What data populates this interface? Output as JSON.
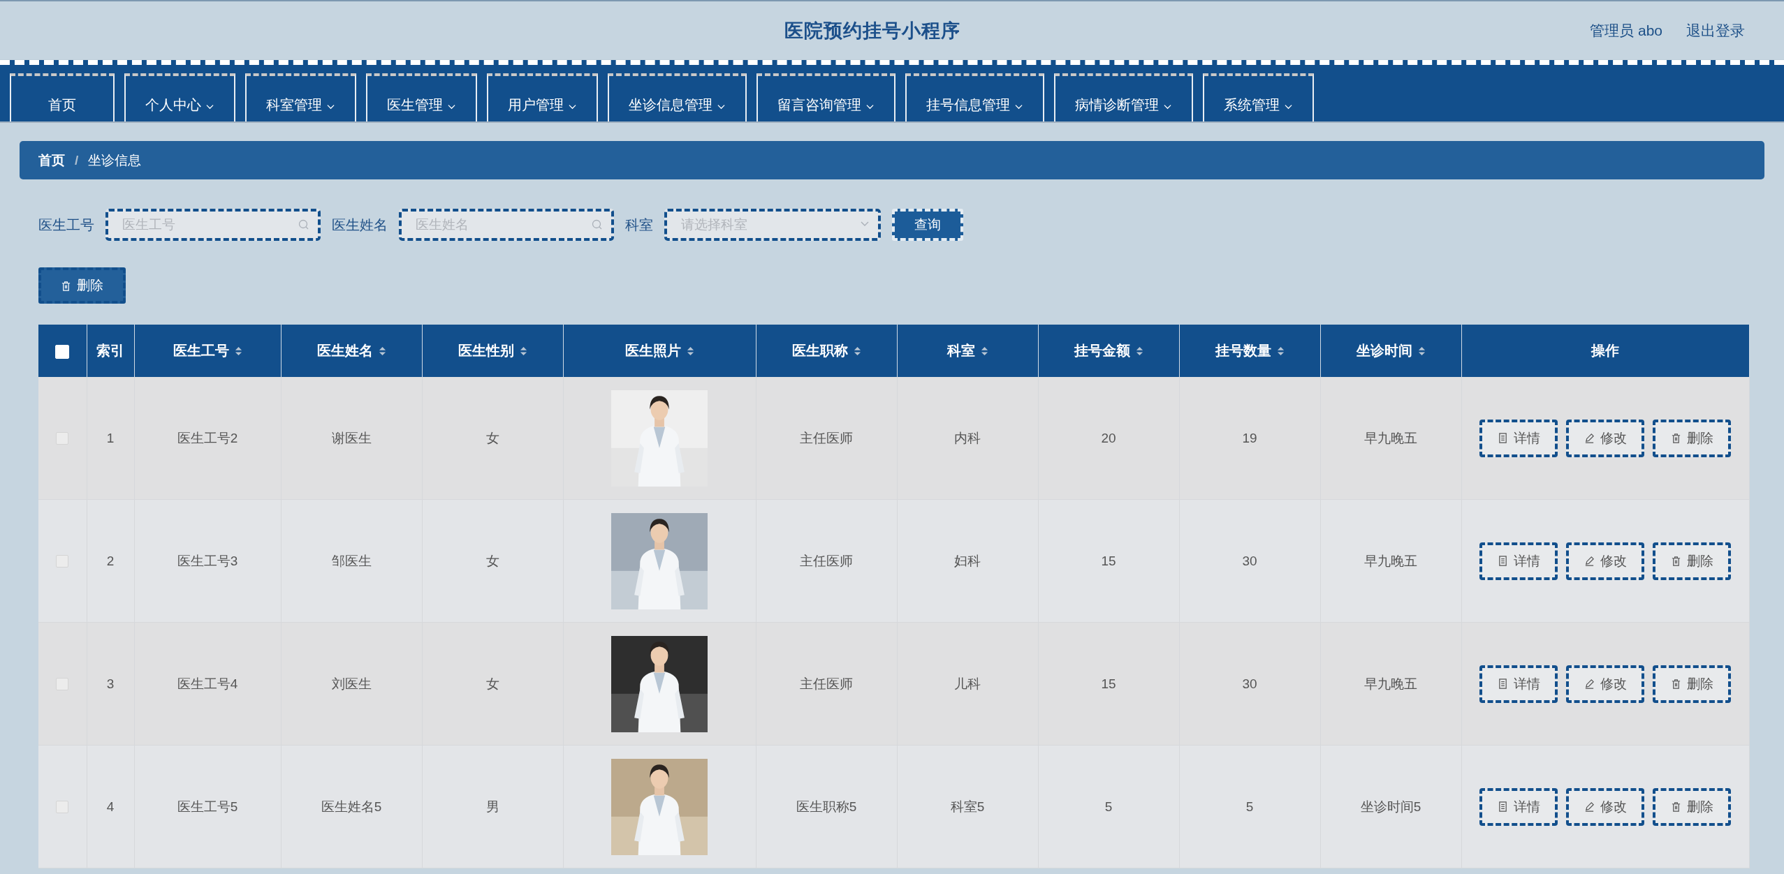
{
  "header": {
    "title": "医院预约挂号小程序",
    "user": "管理员 abo",
    "logout": "退出登录"
  },
  "nav": [
    {
      "label": "首页",
      "dropdown": false
    },
    {
      "label": "个人中心",
      "dropdown": true
    },
    {
      "label": "科室管理",
      "dropdown": true
    },
    {
      "label": "医生管理",
      "dropdown": true
    },
    {
      "label": "用户管理",
      "dropdown": true
    },
    {
      "label": "坐诊信息管理",
      "dropdown": true
    },
    {
      "label": "留言咨询管理",
      "dropdown": true
    },
    {
      "label": "挂号信息管理",
      "dropdown": true
    },
    {
      "label": "病情诊断管理",
      "dropdown": true
    },
    {
      "label": "系统管理",
      "dropdown": true
    }
  ],
  "breadcrumb": {
    "items": [
      "首页",
      "坐诊信息"
    ],
    "separator": "/"
  },
  "search": {
    "fields": [
      {
        "label": "医生工号",
        "placeholder": "医生工号",
        "kind": "text"
      },
      {
        "label": "医生姓名",
        "placeholder": "医生姓名",
        "kind": "text"
      },
      {
        "label": "科室",
        "placeholder": "请选择科室",
        "kind": "select"
      }
    ],
    "button": "查询"
  },
  "bulk_delete": "删除",
  "table": {
    "select_all": {
      "checked": false
    },
    "columns": [
      {
        "label": "索引",
        "sortable": false
      },
      {
        "label": "医生工号",
        "sortable": true
      },
      {
        "label": "医生姓名",
        "sortable": true
      },
      {
        "label": "医生性别",
        "sortable": true
      },
      {
        "label": "医生照片",
        "sortable": true
      },
      {
        "label": "医生职称",
        "sortable": true
      },
      {
        "label": "科室",
        "sortable": true
      },
      {
        "label": "挂号金额",
        "sortable": true
      },
      {
        "label": "挂号数量",
        "sortable": true
      },
      {
        "label": "坐诊时间",
        "sortable": true
      },
      {
        "label": "操作",
        "sortable": false
      }
    ],
    "rows": [
      {
        "checked": false,
        "cells": [
          "1",
          "医生工号2",
          "谢医生",
          "女",
          {
            "kind": "picture"
          },
          "主任医师",
          "内科",
          "20",
          "19",
          "早九晚五",
          {
            "actions": [
              {
                "label": "详情",
                "kind": "detail"
              },
              {
                "label": "修改",
                "kind": "edit"
              },
              {
                "label": "删除",
                "kind": "delete"
              }
            ]
          }
        ]
      },
      {
        "checked": false,
        "cells": [
          "2",
          "医生工号3",
          "邹医生",
          "女",
          {
            "kind": "picture"
          },
          "主任医师",
          "妇科",
          "15",
          "30",
          "早九晚五",
          {
            "actions": [
              {
                "label": "详情",
                "kind": "detail"
              },
              {
                "label": "修改",
                "kind": "edit"
              },
              {
                "label": "删除",
                "kind": "delete"
              }
            ]
          }
        ]
      },
      {
        "checked": false,
        "cells": [
          "3",
          "医生工号4",
          "刘医生",
          "女",
          {
            "kind": "picture"
          },
          "主任医师",
          "儿科",
          "15",
          "30",
          "早九晚五",
          {
            "actions": [
              {
                "label": "详情",
                "kind": "detail"
              },
              {
                "label": "修改",
                "kind": "edit"
              },
              {
                "label": "删除",
                "kind": "delete"
              }
            ]
          }
        ]
      },
      {
        "checked": false,
        "cells": [
          "4",
          "医生工号5",
          "医生姓名5",
          "男",
          {
            "kind": "picture"
          },
          "医生职称5",
          "科室5",
          "5",
          "5",
          "坐诊时间5",
          {
            "actions": [
              {
                "label": "详情",
                "kind": "detail"
              },
              {
                "label": "修改",
                "kind": "edit"
              },
              {
                "label": "删除",
                "kind": "delete"
              }
            ]
          }
        ]
      }
    ]
  }
}
